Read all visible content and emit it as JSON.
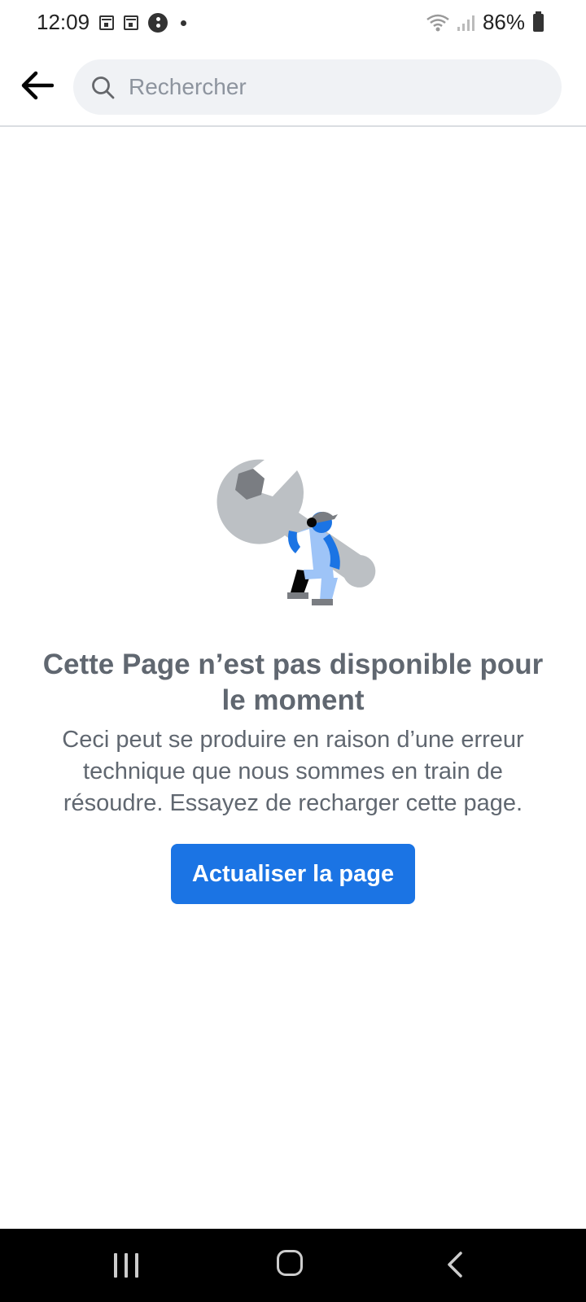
{
  "status_bar": {
    "time": "12:09",
    "battery": "86%"
  },
  "header": {
    "search_placeholder": "Rechercher"
  },
  "error": {
    "title": "Cette Page n’est pas disponible pour le moment",
    "description": "Ceci peut se produire en raison d’une erreur technique que nous sommes en train de résoudre. Essayez de recharger cette page.",
    "button_label": "Actualiser la page"
  },
  "colors": {
    "accent": "#1b74e4",
    "search_bg": "#f0f2f5",
    "text_secondary": "#606770"
  },
  "icons": {
    "back": "arrow-left-icon",
    "search": "search-icon",
    "illustration": "wrench-worker-illustration"
  }
}
